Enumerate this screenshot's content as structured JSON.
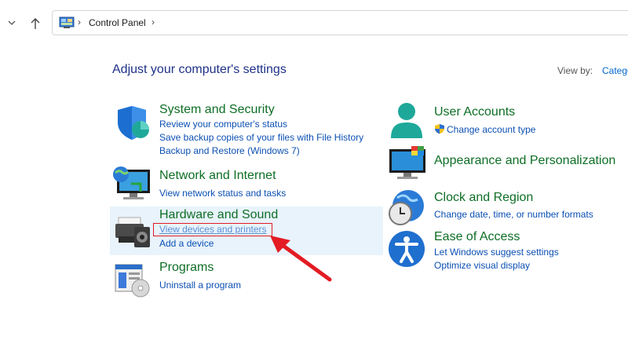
{
  "address_bar": {
    "path": "Control Panel"
  },
  "main": {
    "heading": "Adjust your computer's settings",
    "view_by_label": "View by:",
    "view_by_value": "Category"
  },
  "categories": {
    "system_security": {
      "title": "System and Security",
      "links": [
        "Review your computer's status",
        "Save backup copies of your files with File History",
        "Backup and Restore (Windows 7)"
      ]
    },
    "network": {
      "title": "Network and Internet",
      "links": [
        "View network status and tasks"
      ]
    },
    "hardware": {
      "title": "Hardware and Sound",
      "links": [
        "View devices and printers",
        "Add a device"
      ]
    },
    "programs": {
      "title": "Programs",
      "links": [
        "Uninstall a program"
      ]
    },
    "user_accounts": {
      "title": "User Accounts",
      "links": [
        "Change account type"
      ]
    },
    "appearance": {
      "title": "Appearance and Personalization",
      "links": []
    },
    "clock": {
      "title": "Clock and Region",
      "links": [
        "Change date, time, or number formats"
      ]
    },
    "ease": {
      "title": "Ease of Access",
      "links": [
        "Let Windows suggest settings",
        "Optimize visual display"
      ]
    }
  },
  "colors": {
    "link": "#0b4fb3",
    "category_title": "#0e6e26",
    "heading": "#1e3287",
    "highlight": "#e8f3fc",
    "annotation_red": "#e31b23"
  },
  "icons": [
    "chevron-down-icon",
    "up-arrow-icon",
    "control-panel-icon",
    "shield-icon",
    "network-icon",
    "printer-icon",
    "programs-icon",
    "user-icon",
    "uac-shield-icon",
    "monitor-icon",
    "clock-globe-icon",
    "accessibility-icon"
  ]
}
